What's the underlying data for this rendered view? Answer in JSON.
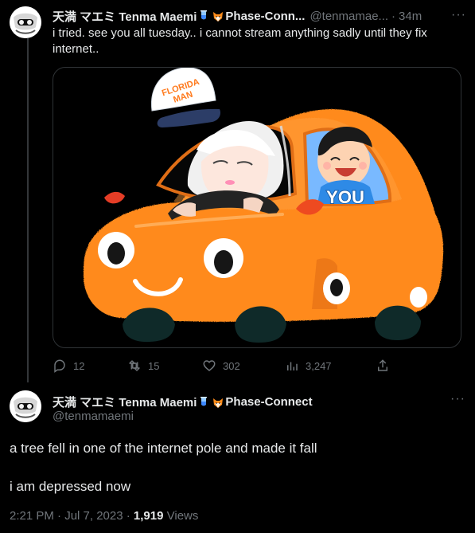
{
  "tweet": {
    "author_name": "天満 マエミ Tenma Maemi",
    "badge_emoji_1": "test-tube-emoji",
    "badge_emoji_2": "fox-emoji",
    "affiliation_truncated": "Phase-Conn...",
    "handle_truncated": "@tenmamae...",
    "separator": "·",
    "time_ago": "34m",
    "more_label": "···",
    "text": "i tried. see you all tuesday.. i cannot stream anything sadly until they fix internet..",
    "media": {
      "hat_text_line1": "FLORIDA",
      "hat_text_line2": "MAN",
      "passenger_label": "YOU"
    },
    "stats": {
      "replies": "12",
      "retweets": "15",
      "likes": "302",
      "views": "3,247"
    }
  },
  "reply": {
    "author_name": "天満 マエミ Tenma Maemi",
    "badge_emoji_1": "test-tube-emoji",
    "badge_emoji_2": "fox-emoji",
    "affiliation": "Phase-Connect",
    "handle": "@tenmamaemi",
    "more_label": "···",
    "line1": "a tree fell in one of the internet pole and made it fall",
    "line2": "i am depressed now",
    "timestamp": "2:21 PM · Jul 7, 2023 · ",
    "views_count": "1,919",
    "views_label": " Views"
  },
  "colors": {
    "background": "#000000",
    "text_primary": "#e7e9ea",
    "text_secondary": "#71767b",
    "border": "#2f3336",
    "car_orange": "#ff8a1f"
  }
}
